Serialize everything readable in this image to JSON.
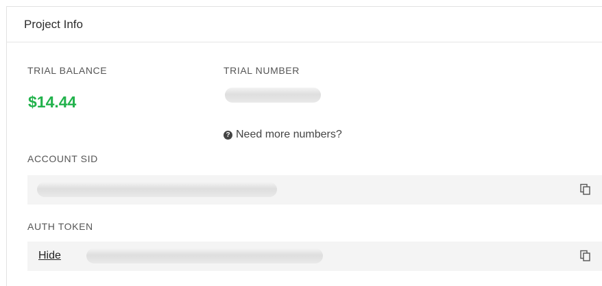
{
  "panel": {
    "title": "Project Info"
  },
  "trial_balance": {
    "label": "TRIAL BALANCE",
    "value": "$14.44"
  },
  "trial_number": {
    "label": "TRIAL NUMBER",
    "help_text": "Need more numbers?",
    "help_icon": "question-circle-icon"
  },
  "account_sid": {
    "label": "ACCOUNT SID",
    "copy_icon": "copy-icon"
  },
  "auth_token": {
    "label": "AUTH TOKEN",
    "hide_label": "Hide",
    "copy_icon": "copy-icon"
  },
  "colors": {
    "balance": "#22b24c",
    "field_bg": "#f4f4f4"
  }
}
